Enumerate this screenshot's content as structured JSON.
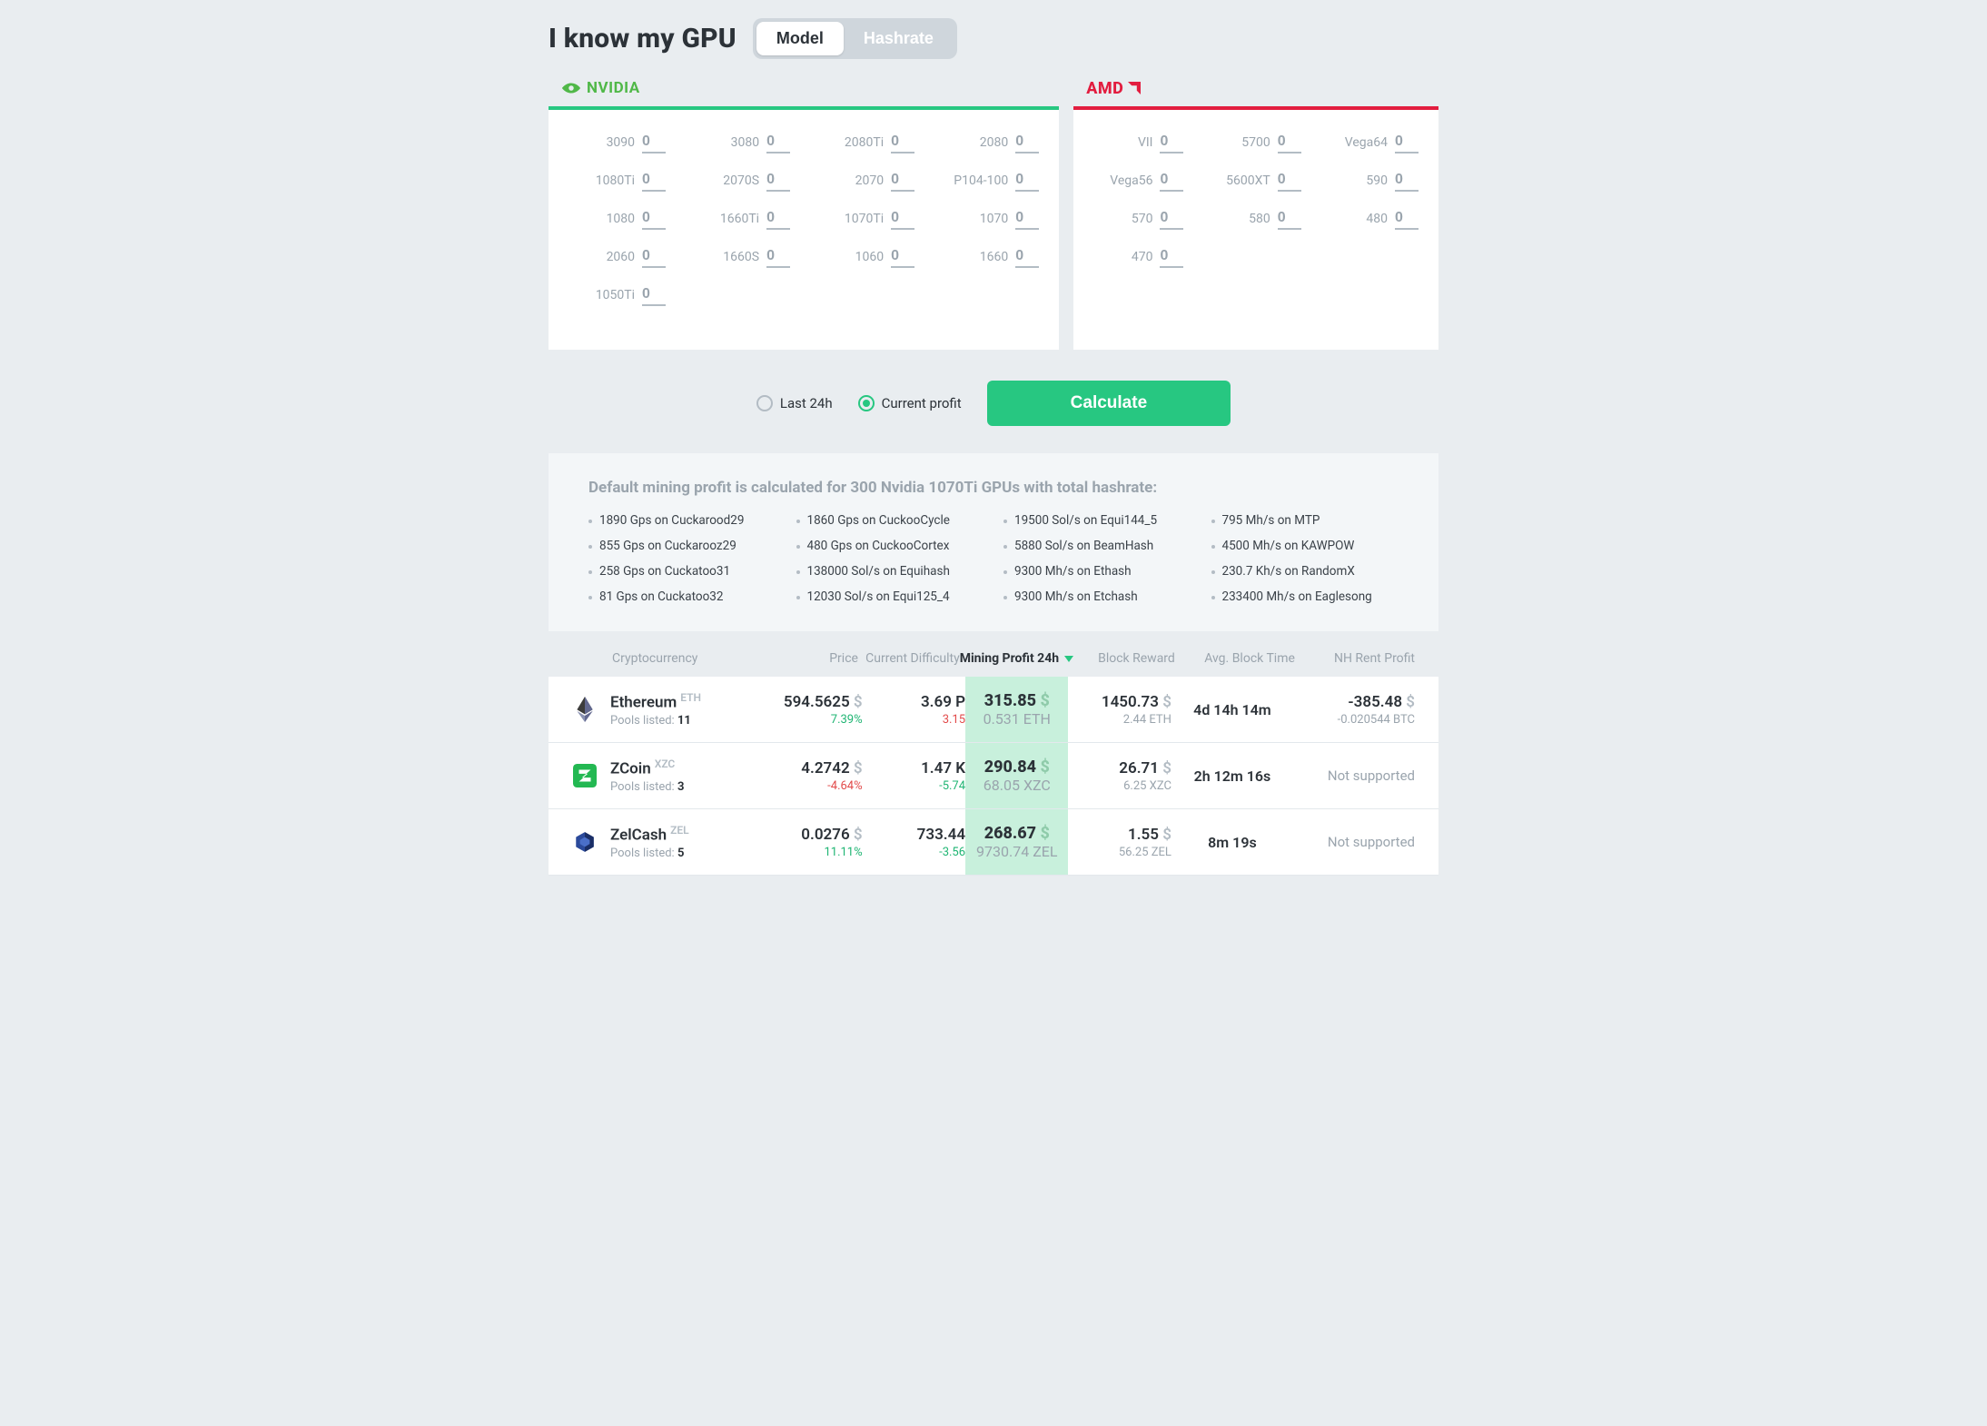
{
  "header": {
    "title": "I know my GPU",
    "tab_model": "Model",
    "tab_hashrate": "Hashrate"
  },
  "brands": {
    "nvidia": {
      "label": "NVIDIA"
    },
    "amd": {
      "label": "AMD"
    }
  },
  "gpus": {
    "nvidia": [
      {
        "label": "3090",
        "value": "0"
      },
      {
        "label": "3080",
        "value": "0"
      },
      {
        "label": "2080Ti",
        "value": "0"
      },
      {
        "label": "2080",
        "value": "0"
      },
      {
        "label": "1080Ti",
        "value": "0"
      },
      {
        "label": "2070S",
        "value": "0"
      },
      {
        "label": "2070",
        "value": "0"
      },
      {
        "label": "P104-100",
        "value": "0"
      },
      {
        "label": "1080",
        "value": "0"
      },
      {
        "label": "1660Ti",
        "value": "0"
      },
      {
        "label": "1070Ti",
        "value": "0"
      },
      {
        "label": "1070",
        "value": "0"
      },
      {
        "label": "2060",
        "value": "0"
      },
      {
        "label": "1660S",
        "value": "0"
      },
      {
        "label": "1060",
        "value": "0"
      },
      {
        "label": "1660",
        "value": "0"
      },
      {
        "label": "1050Ti",
        "value": "0"
      }
    ],
    "amd": [
      {
        "label": "VII",
        "value": "0"
      },
      {
        "label": "5700",
        "value": "0"
      },
      {
        "label": "Vega64",
        "value": "0"
      },
      {
        "label": "Vega56",
        "value": "0"
      },
      {
        "label": "5600XT",
        "value": "0"
      },
      {
        "label": "590",
        "value": "0"
      },
      {
        "label": "570",
        "value": "0"
      },
      {
        "label": "580",
        "value": "0"
      },
      {
        "label": "480",
        "value": "0"
      },
      {
        "label": "470",
        "value": "0"
      }
    ]
  },
  "controls": {
    "radio_24h": "Last 24h",
    "radio_current": "Current profit",
    "calculate": "Calculate"
  },
  "default": {
    "title": "Default mining profit is calculated for 300 Nvidia 1070Ti GPUs with total hashrate:",
    "items": [
      "1890 Gps on Cuckarood29",
      "1860 Gps on CuckooCycle",
      "19500 Sol/s on Equi144_5",
      "795 Mh/s on MTP",
      "855 Gps on Cuckarooz29",
      "480 Gps on CuckooCortex",
      "5880 Sol/s on BeamHash",
      "4500 Mh/s on KAWPOW",
      "258 Gps on Cuckatoo31",
      "138000 Sol/s on Equihash",
      "9300 Mh/s on Ethash",
      "230.7 Kh/s on RandomX",
      "81 Gps on Cuckatoo32",
      "12030 Sol/s on Equi125_4",
      "9300 Mh/s on Etchash",
      "233400 Mh/s on Eaglesong"
    ]
  },
  "table": {
    "headers": {
      "crypto": "Cryptocurrency",
      "price": "Price",
      "difficulty": "Current Difficulty",
      "profit": "Mining Profit 24h",
      "reward": "Block Reward",
      "blocktime": "Avg. Block Time",
      "rent": "NH Rent Profit"
    },
    "pools_label": "Pools listed:",
    "rows": [
      {
        "name": "Ethereum",
        "sym": "ETH",
        "pools": "11",
        "price": "594.5625",
        "price_delta": "7.39%",
        "price_dir": "pos",
        "diff": "3.69 P",
        "diff_delta": "3.15",
        "diff_dir": "neg",
        "profit_usd": "315.85",
        "profit_coin": "0.531 ETH",
        "reward": "1450.73",
        "reward_coin": "2.44 ETH",
        "blocktime": "4d 14h 14m",
        "rent": "-385.48",
        "rent_sub": "-0.020544 BTC",
        "rent_supported": true,
        "icon": "eth"
      },
      {
        "name": "ZCoin",
        "sym": "XZC",
        "pools": "3",
        "price": "4.2742",
        "price_delta": "-4.64%",
        "price_dir": "neg",
        "diff": "1.47 K",
        "diff_delta": "-5.74",
        "diff_dir": "pos",
        "profit_usd": "290.84",
        "profit_coin": "68.05 XZC",
        "reward": "26.71",
        "reward_coin": "6.25 XZC",
        "blocktime": "2h 12m 16s",
        "rent": "Not supported",
        "rent_sub": "",
        "rent_supported": false,
        "icon": "xzc"
      },
      {
        "name": "ZelCash",
        "sym": "ZEL",
        "pools": "5",
        "price": "0.0276",
        "price_delta": "11.11%",
        "price_dir": "pos",
        "diff": "733.44",
        "diff_delta": "-3.56",
        "diff_dir": "pos",
        "profit_usd": "268.67",
        "profit_coin": "9730.74 ZEL",
        "reward": "1.55",
        "reward_coin": "56.25 ZEL",
        "blocktime": "8m 19s",
        "rent": "Not supported",
        "rent_sub": "",
        "rent_supported": false,
        "icon": "zel"
      }
    ]
  }
}
